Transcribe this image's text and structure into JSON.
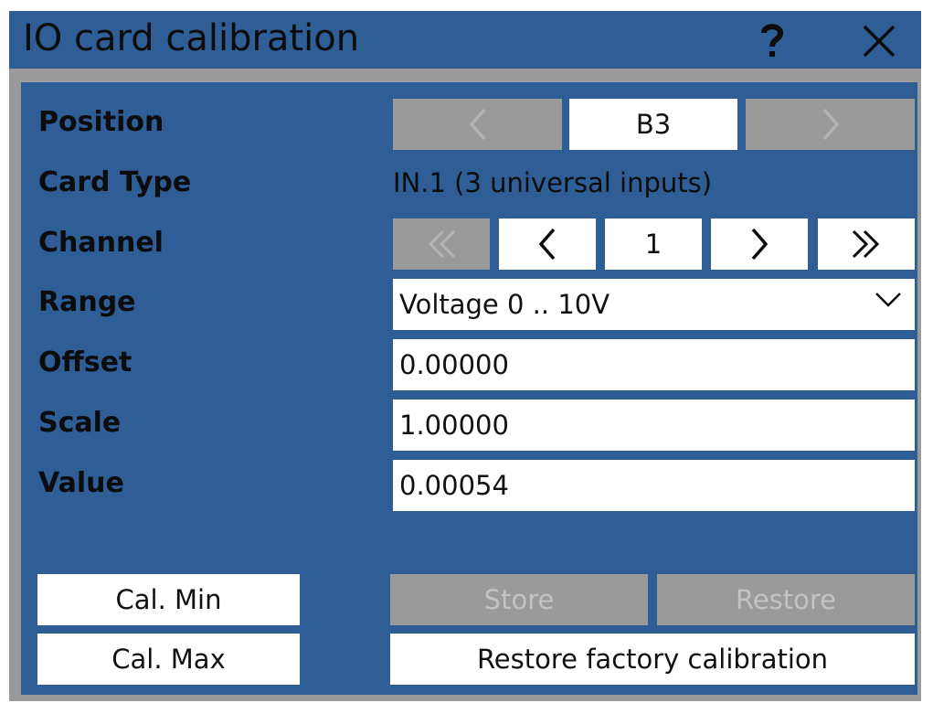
{
  "window": {
    "title": "IO card calibration",
    "help_icon": "question-mark-icon",
    "close_icon": "close-x-icon"
  },
  "position": {
    "label": "Position",
    "value": "B3",
    "prev_icon": "chevron-left-icon",
    "next_icon": "chevron-right-icon"
  },
  "card_type": {
    "label": "Card Type",
    "value": "IN.1 (3 universal inputs)"
  },
  "channel": {
    "label": "Channel",
    "value": "1",
    "first_icon": "double-chevron-left-icon",
    "prev_icon": "chevron-left-icon",
    "next_icon": "chevron-right-icon",
    "last_icon": "double-chevron-right-icon"
  },
  "range": {
    "label": "Range",
    "selected": "Voltage 0 .. 10V",
    "dropdown_icon": "chevron-down-icon"
  },
  "offset": {
    "label": "Offset",
    "value": "0.00000"
  },
  "scale": {
    "label": "Scale",
    "value": "1.00000"
  },
  "value": {
    "label": "Value",
    "value": "0.00054"
  },
  "buttons": {
    "cal_min": "Cal. Min",
    "cal_max": "Cal. Max",
    "store": "Store",
    "restore": "Restore",
    "restore_factory": "Restore factory calibration"
  },
  "colors": {
    "panel_blue": "#2f5d96",
    "frame_gray": "#9a9a9a",
    "disabled_text": "#c3c3c3",
    "field_white": "#ffffff",
    "text_dark": "#0c0c0c"
  }
}
